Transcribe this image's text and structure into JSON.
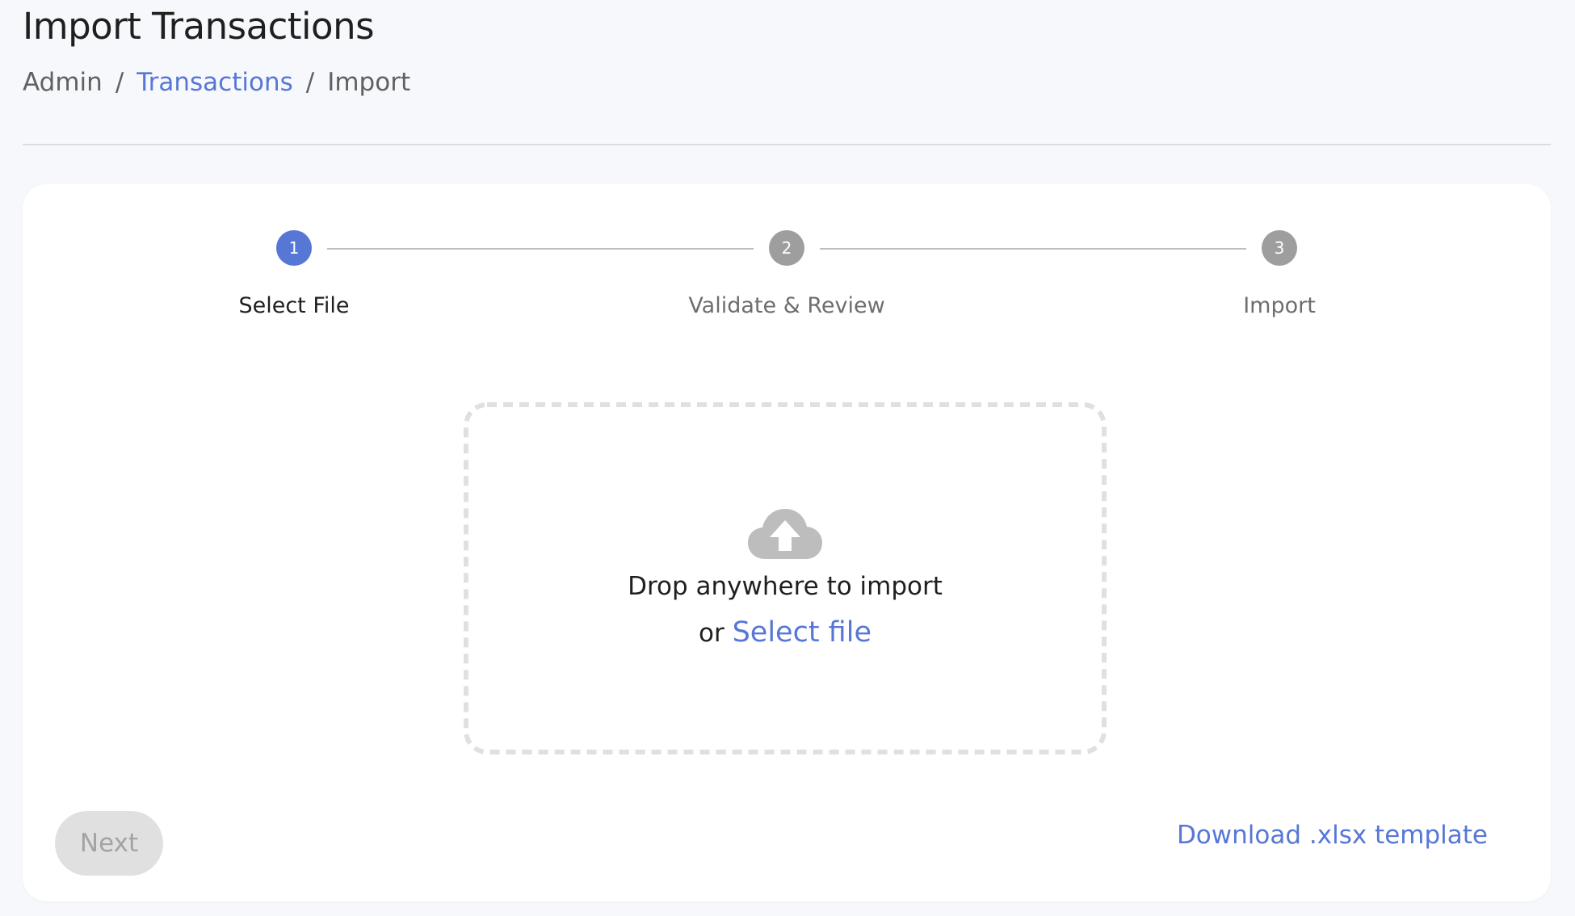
{
  "header": {
    "title": "Import Transactions",
    "breadcrumb": [
      {
        "label": "Admin",
        "link": false
      },
      {
        "label": "Transactions",
        "link": true
      },
      {
        "label": "Import",
        "link": false
      }
    ],
    "separator": "/"
  },
  "stepper": {
    "current_step": 1,
    "steps": [
      {
        "number": "1",
        "label": "Select File",
        "state": "active"
      },
      {
        "number": "2",
        "label": "Validate & Review",
        "state": "inactive"
      },
      {
        "number": "3",
        "label": "Import",
        "state": "inactive"
      }
    ]
  },
  "dropzone": {
    "icon": "cloud-upload-icon",
    "primary_text": "Drop anywhere to import",
    "or_text": "or",
    "select_link": "Select file"
  },
  "footer": {
    "next_label": "Next",
    "next_disabled": true,
    "download_link": "Download .xlsx template"
  },
  "colors": {
    "accent": "#5677d6",
    "inactive_step": "#9e9e9e",
    "disabled_button_bg": "#e0e0e0",
    "page_bg": "#f7f8fc"
  }
}
